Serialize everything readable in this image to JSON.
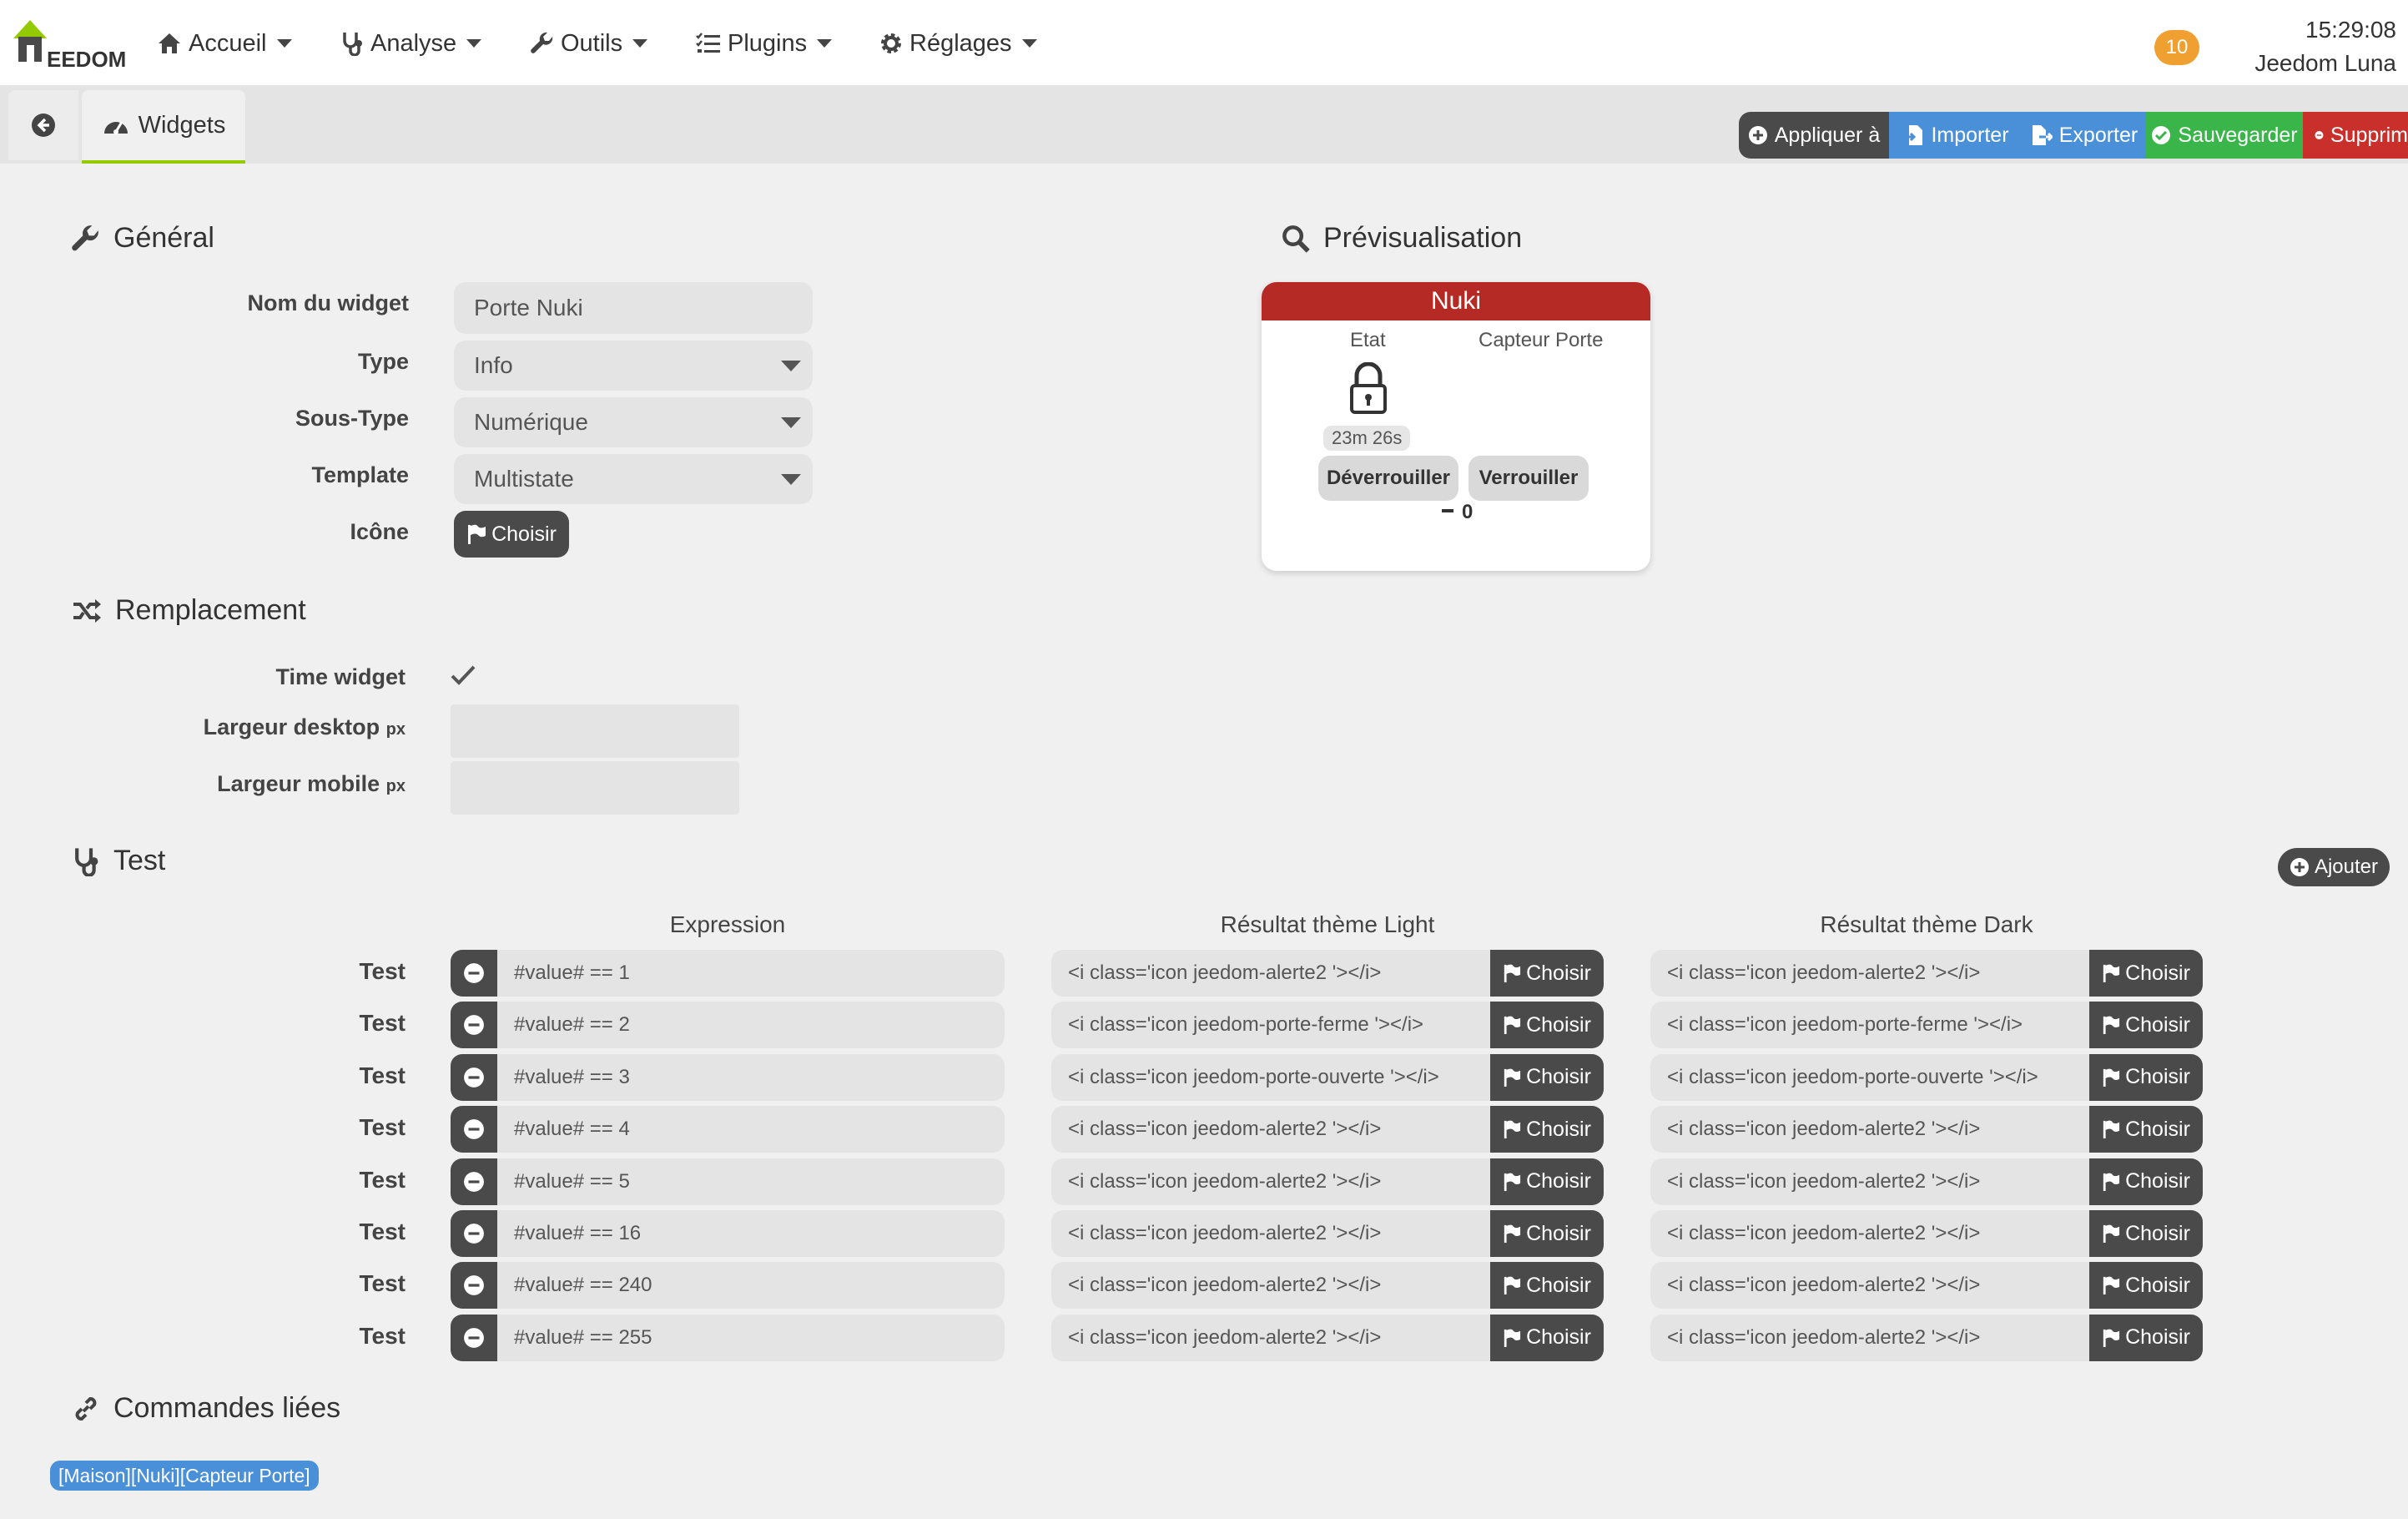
{
  "nav": {
    "logo_text": "EEDOM",
    "items": [
      {
        "label": "Accueil",
        "icon": "home-icon"
      },
      {
        "label": "Analyse",
        "icon": "stethoscope-icon"
      },
      {
        "label": "Outils",
        "icon": "wrench-icon"
      },
      {
        "label": "Plugins",
        "icon": "tasks-icon"
      },
      {
        "label": "Réglages",
        "icon": "cog-icon"
      }
    ],
    "notification_count": "10",
    "time": "15:29:08",
    "user": "Jeedom Luna"
  },
  "tabs": {
    "active": "Widgets"
  },
  "actions": {
    "apply": "Appliquer à",
    "import": "Importer",
    "export": "Exporter",
    "save": "Sauvegarder",
    "delete": "Supprim"
  },
  "colors": {
    "accent_green": "#94ca02",
    "apply_bg": "#4a4a4a",
    "import_bg": "#4a90d9",
    "export_bg": "#4a90d9",
    "save_bg": "#39b54a",
    "delete_bg": "#c9302c",
    "preview_header": "#b52a25"
  },
  "general": {
    "title": "Général",
    "name_label": "Nom du widget",
    "name_value": "Porte Nuki",
    "type_label": "Type",
    "type_value": "Info",
    "subtype_label": "Sous-Type",
    "subtype_value": "Numérique",
    "template_label": "Template",
    "template_value": "Multistate",
    "icon_label": "Icône",
    "choose": "Choisir"
  },
  "preview": {
    "title": "Prévisualisation",
    "widget_name": "Nuki",
    "etat": "Etat",
    "capteur": "Capteur Porte",
    "duration": "23m 26s",
    "unlock": "Déverrouiller",
    "lock": "Verrouiller",
    "value": "0"
  },
  "replacement": {
    "title": "Remplacement",
    "time_widget": "Time widget",
    "desktop_width": "Largeur desktop",
    "mobile_width": "Largeur mobile",
    "unit": "px"
  },
  "test": {
    "title": "Test",
    "add": "Ajouter",
    "col_expression": "Expression",
    "col_light": "Résultat thème Light",
    "col_dark": "Résultat thème Dark",
    "row_label": "Test",
    "choose": "Choisir",
    "rows": [
      {
        "expr": "#value# == 1",
        "light": "<i class='icon jeedom-alerte2 '></i>",
        "dark": "<i class='icon jeedom-alerte2 '></i>"
      },
      {
        "expr": "#value# == 2",
        "light": "<i class='icon jeedom-porte-ferme '></i>",
        "dark": "<i class='icon jeedom-porte-ferme '></i>"
      },
      {
        "expr": "#value# == 3",
        "light": "<i class='icon jeedom-porte-ouverte '></i>",
        "dark": "<i class='icon jeedom-porte-ouverte '></i>"
      },
      {
        "expr": "#value# == 4",
        "light": "<i class='icon jeedom-alerte2 '></i>",
        "dark": "<i class='icon jeedom-alerte2 '></i>"
      },
      {
        "expr": "#value# == 5",
        "light": "<i class='icon jeedom-alerte2 '></i>",
        "dark": "<i class='icon jeedom-alerte2 '></i>"
      },
      {
        "expr": "#value# == 16",
        "light": "<i class='icon jeedom-alerte2 '></i>",
        "dark": "<i class='icon jeedom-alerte2 '></i>"
      },
      {
        "expr": "#value# == 240",
        "light": "<i class='icon jeedom-alerte2 '></i>",
        "dark": "<i class='icon jeedom-alerte2 '></i>"
      },
      {
        "expr": "#value# == 255",
        "light": "<i class='icon jeedom-alerte2 '></i>",
        "dark": "<i class='icon jeedom-alerte2 '></i>"
      }
    ]
  },
  "linked": {
    "title": "Commandes liées",
    "item": "[Maison][Nuki][Capteur Porte]"
  }
}
